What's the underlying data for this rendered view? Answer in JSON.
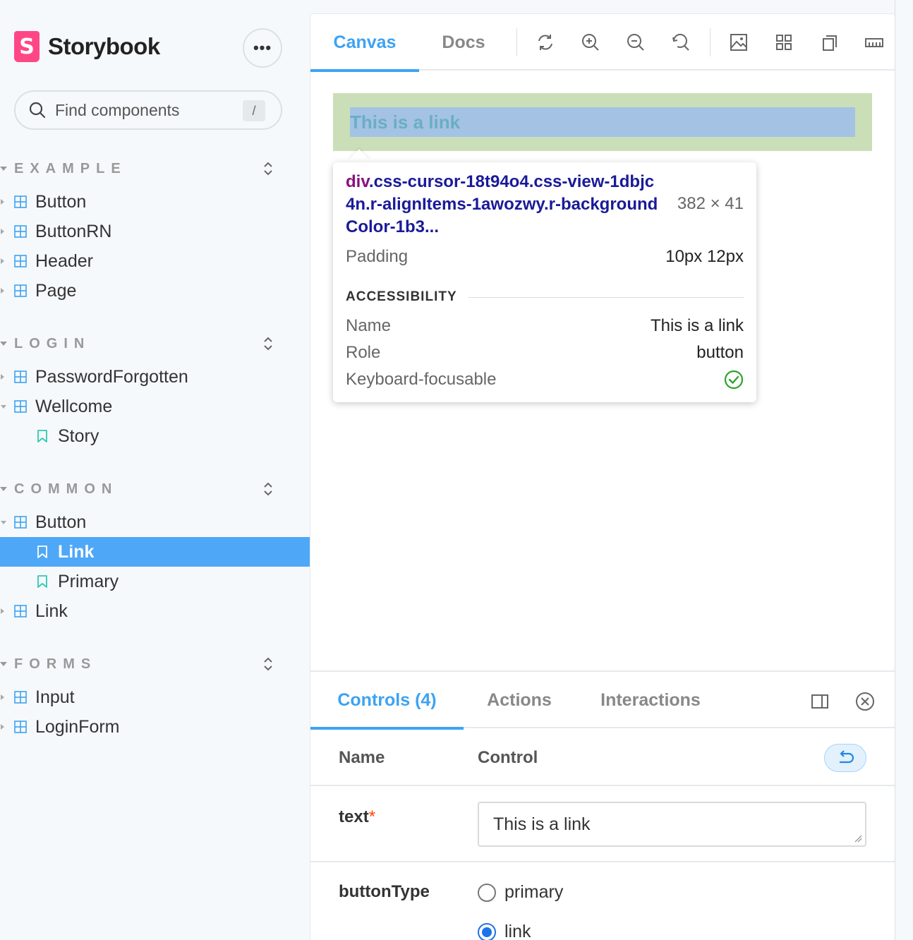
{
  "brand": {
    "name": "Storybook",
    "logo_letter": "S",
    "menu_label": "•••"
  },
  "search": {
    "placeholder": "Find components",
    "shortcut": "/"
  },
  "sidebar": {
    "groups": [
      {
        "title": "EXAMPLE",
        "items": [
          {
            "label": "Button"
          },
          {
            "label": "ButtonRN"
          },
          {
            "label": "Header"
          },
          {
            "label": "Page"
          }
        ]
      },
      {
        "title": "LOGIN",
        "items": [
          {
            "label": "PasswordForgotten"
          },
          {
            "label": "Wellcome"
          },
          {
            "label": "Story"
          }
        ]
      },
      {
        "title": "COMMON",
        "items": [
          {
            "label": "Button"
          },
          {
            "label": "Link"
          },
          {
            "label": "Primary"
          },
          {
            "label": "Link"
          }
        ]
      },
      {
        "title": "FORMS",
        "items": [
          {
            "label": "Input"
          },
          {
            "label": "LoginForm"
          }
        ]
      }
    ]
  },
  "toolbar": {
    "tabs": [
      {
        "label": "Canvas"
      },
      {
        "label": "Docs"
      }
    ],
    "icons": [
      "reload-icon",
      "zoom-in-icon",
      "zoom-out-icon",
      "zoom-reset-icon",
      "background-icon",
      "grid-icon",
      "viewport-icon",
      "measure-icon"
    ]
  },
  "preview": {
    "link_text": "This is a link"
  },
  "inspector": {
    "selector_tag": "div",
    "selector_rest": ".css-cursor-18t94o4.css-view-1dbjc4n.r-alignItems-1awozwy.r-backgroundColor-1b3...",
    "size": "382 × 41",
    "padding_label": "Padding",
    "padding_value": "10px 12px",
    "section_title": "ACCESSIBILITY",
    "name_label": "Name",
    "name_value": "This is a link",
    "role_label": "Role",
    "role_value": "button",
    "focus_label": "Keyboard-focusable"
  },
  "addons": {
    "tabs": [
      {
        "label": "Controls (4)"
      },
      {
        "label": "Actions"
      },
      {
        "label": "Interactions"
      }
    ],
    "col_name": "Name",
    "col_control": "Control",
    "rows": {
      "text": {
        "name": "text",
        "required_mark": "*",
        "value": "This is a link"
      },
      "buttonType": {
        "name": "buttonType",
        "options": [
          {
            "label": "primary",
            "checked": false
          },
          {
            "label": "link",
            "checked": true
          }
        ]
      }
    }
  },
  "colors": {
    "accent": "#3da3f2",
    "selected": "#4ea8f7",
    "brand": "#ff4785",
    "success": "#2ca32c"
  }
}
